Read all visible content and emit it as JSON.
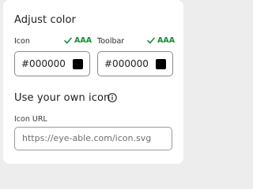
{
  "adjust": {
    "title": "Adjust color",
    "icon": {
      "label": "Icon",
      "badge": "AAA",
      "value": "#000000",
      "swatch_color": "#000000"
    },
    "toolbar": {
      "label": "Toolbar",
      "badge": "AAA",
      "value": "#000000",
      "swatch_color": "#000000"
    }
  },
  "own_icon": {
    "title": "Use your own icon",
    "info_icon": "info-icon",
    "url_label": "Icon URL",
    "url_placeholder": "https://eye-able.com/icon.svg"
  },
  "colors": {
    "badge_green": "#1a8a3a"
  }
}
